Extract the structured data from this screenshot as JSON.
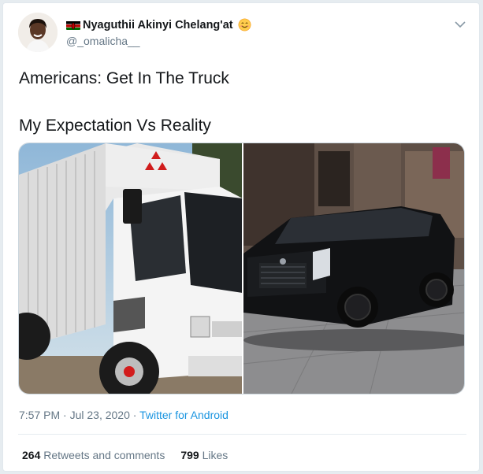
{
  "tweet": {
    "author": {
      "display_name": "Nyaguthii Akinyi Chelang'at",
      "handle": "@_omalicha__",
      "flag_icon": "kenya-flag-icon",
      "emoji_icon": "smiling-face-emoji-icon"
    },
    "text_line1": "Americans: Get In The Truck",
    "text_line2": "My Expectation Vs Reality",
    "media": {
      "left": "white-mitsubishi-box-truck-photo",
      "right": "black-cadillac-escalade-photo"
    },
    "time": "7:57 PM",
    "date": "Jul 23, 2020",
    "separator": "·",
    "source": "Twitter for Android",
    "stats": {
      "retweets_count": "264",
      "retweets_label": "Retweets and comments",
      "likes_count": "799",
      "likes_label": "Likes"
    }
  },
  "colors": {
    "link": "#1b95e0",
    "muted": "#657786",
    "text": "#14171a",
    "border": "#e1e8ed"
  }
}
